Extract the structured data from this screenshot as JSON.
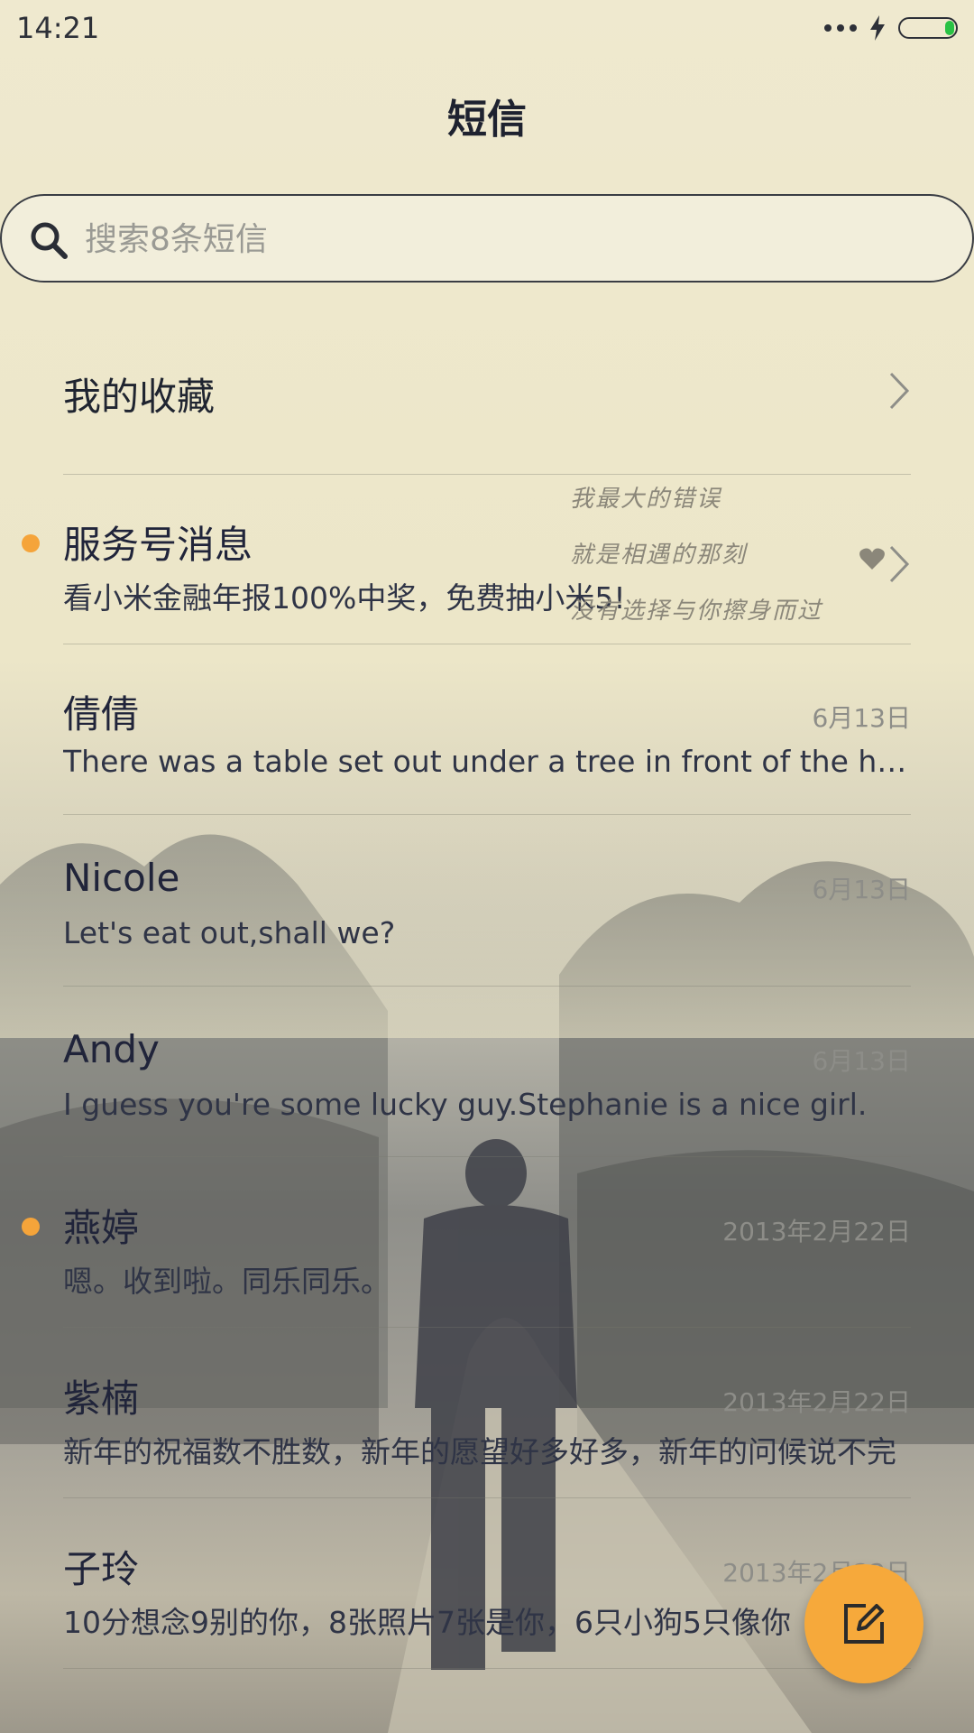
{
  "status_bar": {
    "time": "14:21",
    "battery_color": "#29c244"
  },
  "header": {
    "title": "短信"
  },
  "search": {
    "placeholder": "搜索8条短信"
  },
  "favorites": {
    "label": "我的收藏"
  },
  "poem": {
    "line1": "我最大的错误",
    "line2": "就是相遇的那刻",
    "line3": "没有选择与你擦身而过"
  },
  "conversations": [
    {
      "name": "服务号消息",
      "preview": "看小米金融年报100%中奖，免费抽小米5!",
      "date": "",
      "unread": true
    },
    {
      "name": "倩倩",
      "preview": "There was a table set out under a tree in front of the house",
      "date": "6月13日",
      "unread": false
    },
    {
      "name": "Nicole",
      "preview": "Let's eat out,shall we?",
      "date": "6月13日",
      "unread": false
    },
    {
      "name": "Andy",
      "preview": "I guess you're some lucky guy.Stephanie is a nice girl.",
      "date": "6月13日",
      "unread": false
    },
    {
      "name": "燕婷",
      "preview": "嗯。收到啦。同乐同乐。",
      "date": "2013年2月22日",
      "unread": true
    },
    {
      "name": "紫楠",
      "preview": "新年的祝福数不胜数，新年的愿望好多好多，新年的问候说不完",
      "date": "2013年2月22日",
      "unread": false
    },
    {
      "name": "子玲",
      "preview": "10分想念9别的你，8张照片7张是你，6只小狗5只像你",
      "date": "2013年2月22日",
      "unread": false
    }
  ],
  "colors": {
    "accent": "#f6a93b",
    "unread_dot": "#f5a43a"
  },
  "icons": {
    "search": "search-icon",
    "chevron": "chevron-right-icon",
    "compose": "compose-icon",
    "charging": "charging-icon",
    "heart": "heart-icon"
  }
}
